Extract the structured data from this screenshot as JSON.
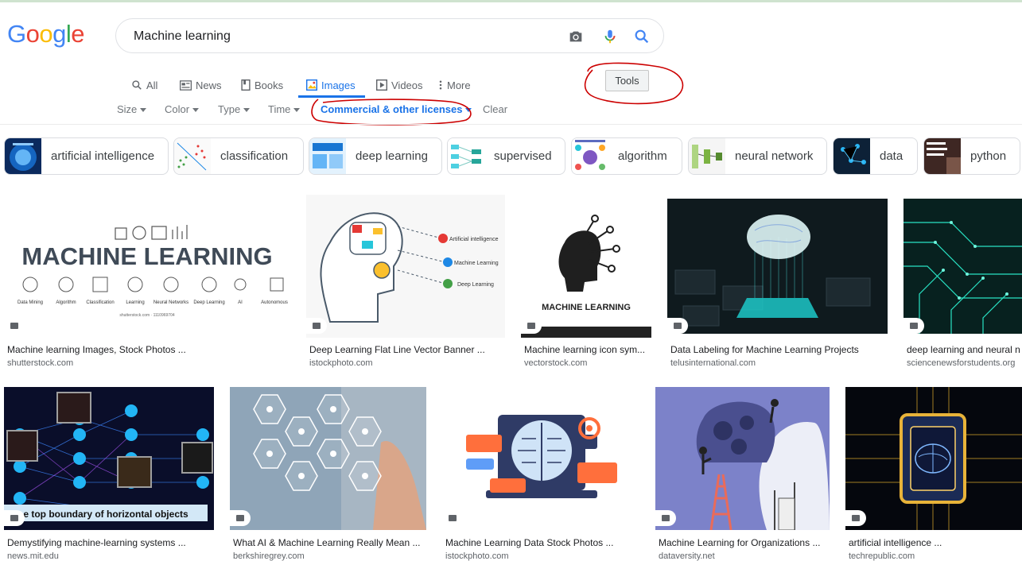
{
  "logo": {
    "letters": [
      "G",
      "o",
      "o",
      "g",
      "l",
      "e"
    ],
    "colors": [
      "#4285f4",
      "#ea4335",
      "#fbbc05",
      "#4285f4",
      "#34a853",
      "#ea4335"
    ]
  },
  "search": {
    "value": "Machine learning",
    "camera_icon": "camera-icon",
    "mic_icon": "mic-icon",
    "search_icon": "search-icon"
  },
  "tabs": [
    {
      "label": "All",
      "icon": "search-icon"
    },
    {
      "label": "News",
      "icon": "news-icon"
    },
    {
      "label": "Books",
      "icon": "book-icon"
    },
    {
      "label": "Images",
      "icon": "image-icon",
      "active": true
    },
    {
      "label": "Videos",
      "icon": "play-icon"
    },
    {
      "label": "More",
      "icon": "more-dots-icon"
    }
  ],
  "tools": {
    "label": "Tools"
  },
  "filters": {
    "size": "Size",
    "color": "Color",
    "type": "Type",
    "time": "Time",
    "license": "Commercial & other licenses",
    "clear": "Clear"
  },
  "chips": [
    "artificial intelligence",
    "classification",
    "deep learning",
    "supervised",
    "algorithm",
    "neural network",
    "data",
    "python"
  ],
  "results_row1": [
    {
      "title": "Machine learning Images, Stock Photos ...",
      "source": "shutterstock.com",
      "img_heading": "MACHINE LEARNING"
    },
    {
      "title": "Deep Learning Flat Line Vector Banner ...",
      "source": "istockphoto.com",
      "img_labels": [
        "Artificial intelligence",
        "Machine Learning",
        "Deep Learning"
      ]
    },
    {
      "title": "Machine learning icon sym...",
      "source": "vectorstock.com",
      "img_heading": "MACHINE LEARNING"
    },
    {
      "title": "Data Labeling for Machine Learning Projects",
      "source": "telusinternational.com"
    },
    {
      "title": "deep learning and neural n",
      "source": "sciencenewsforstudents.org"
    }
  ],
  "results_row2": [
    {
      "title": "Demystifying machine-learning systems ...",
      "source": "news.mit.edu",
      "img_caption": "e top boundary of horizontal objects"
    },
    {
      "title": "What AI & Machine Learning Really Mean ...",
      "source": "berkshiregrey.com"
    },
    {
      "title": "Machine Learning Data Stock Photos ...",
      "source": "istockphoto.com"
    },
    {
      "title": "Machine Learning for Organizations ...",
      "source": "dataversity.net"
    },
    {
      "title": "artificial intelligence ...",
      "source": "techrepublic.com"
    }
  ],
  "colors": {
    "accent": "#1a73e8",
    "annotation": "#cc0000"
  }
}
